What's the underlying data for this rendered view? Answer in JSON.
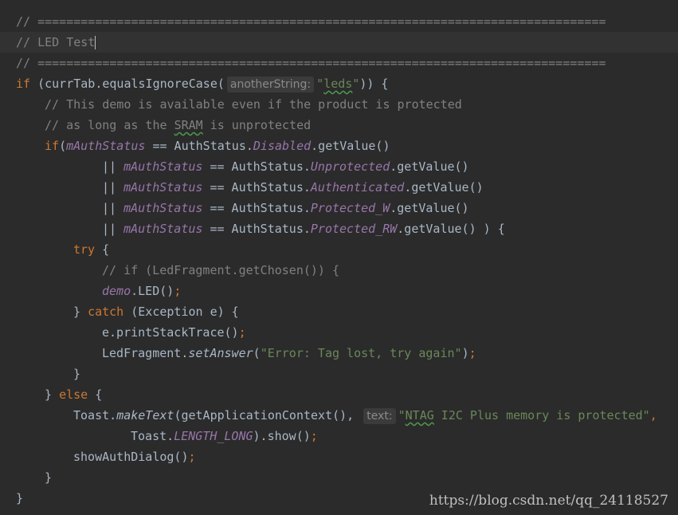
{
  "code": {
    "l1": "// ===============================================================================",
    "l2": "// LED Test",
    "l3": "// ===============================================================================",
    "l4": {
      "kw": "if",
      "a": " (currTab.equalsIgnoreCase(",
      "hint": "anotherString:",
      "str_q1": "\"",
      "str_word": "leds",
      "str_q2": "\"",
      "b": ")) {"
    },
    "l5": "// This demo is available even if the product is protected",
    "l6": {
      "a": "// as long as the ",
      "b": "SRAM",
      "c": " is unprotected"
    },
    "l7": {
      "kw": "if",
      "p": "(",
      "fld": "mAuthStatus",
      "a": " == AuthStatus.",
      "st": "Disabled",
      "b": ".getValue()"
    },
    "l8": {
      "op": "|| ",
      "fld": "mAuthStatus",
      "a": " == AuthStatus.",
      "st": "Unprotected",
      "b": ".getValue()"
    },
    "l9": {
      "op": "|| ",
      "fld": "mAuthStatus",
      "a": " == AuthStatus.",
      "st": "Authenticated",
      "b": ".getValue()"
    },
    "l10": {
      "op": "|| ",
      "fld": "mAuthStatus",
      "a": " == AuthStatus.",
      "st": "Protected_W",
      "b": ".getValue()"
    },
    "l11": {
      "op": "|| ",
      "fld": "mAuthStatus",
      "a": " == AuthStatus.",
      "st": "Protected_RW",
      "b": ".getValue() ) {"
    },
    "l12": {
      "kw": "try",
      "b": " {"
    },
    "l13": "// if (LedFragment.getChosen()) {",
    "l14": {
      "fld": "demo",
      "a": ".LED()",
      "semi": ";"
    },
    "l15": {
      "a": "} ",
      "kw": "catch",
      "b": " (Exception e) {"
    },
    "l16": {
      "a": "e.printStackTrace()",
      "semi": ";"
    },
    "l17": {
      "a": "LedFragment.",
      "st": "setAnswer",
      "p": "(",
      "str": "\"Error: Tag lost, try again\"",
      "b": ")",
      "semi": ";"
    },
    "l18": "}",
    "l19": {
      "a": "} ",
      "kw": "else",
      "b": " {"
    },
    "l20": {
      "a": "Toast.",
      "st": "makeText",
      "b": "(getApplicationContext(),",
      "hint": "text:",
      "str_q1": "\"",
      "str_word": "NTAG",
      "str_rest": " I2C Plus memory is protected\"",
      "c": ","
    },
    "l21": {
      "a": "Toast.",
      "fld": "LENGTH_LONG",
      "b": ").show()",
      "semi": ";"
    },
    "l22": {
      "a": "showAuthDialog()",
      "semi": ";"
    },
    "l23": "}",
    "l24": "}"
  },
  "watermark": "https://blog.csdn.net/qq_24118527",
  "colors": {
    "background": "#2b2b2b",
    "keyword": "#cc7832",
    "comment": "#808080",
    "string": "#6a8759",
    "field": "#9876aa"
  }
}
